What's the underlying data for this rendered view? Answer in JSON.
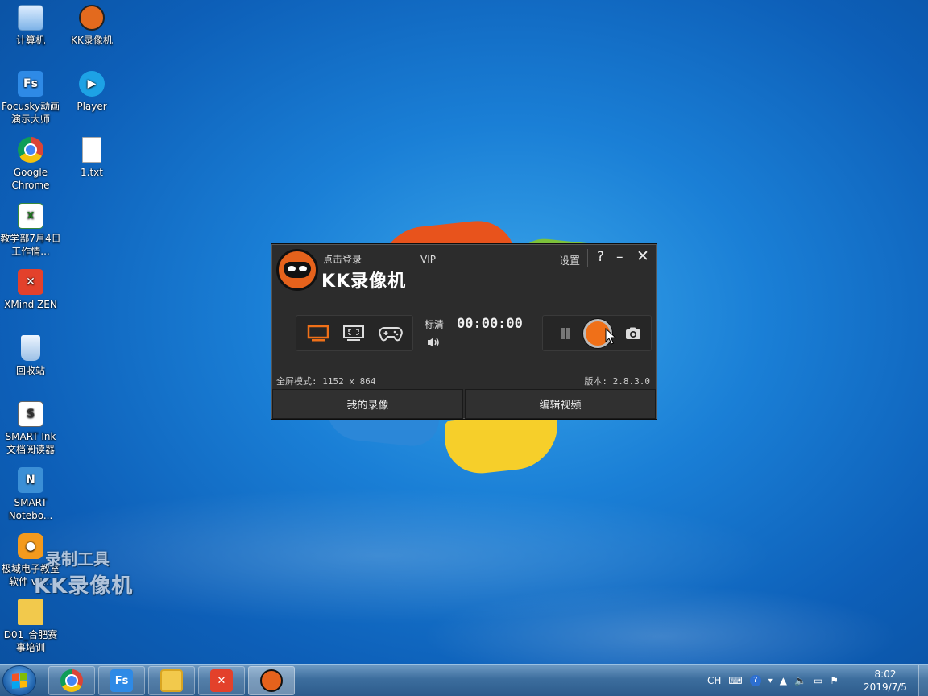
{
  "desktop": {
    "icons": [
      {
        "label": "计算机",
        "glyph": ""
      },
      {
        "label": "KK录像机",
        "glyph": ""
      },
      {
        "label": "Focusky动画演示大师",
        "glyph": "Fs"
      },
      {
        "label": "Player",
        "glyph": "▶"
      },
      {
        "label": "Google Chrome",
        "glyph": ""
      },
      {
        "label": "1.txt",
        "glyph": ""
      },
      {
        "label": "教学部7月4日工作情...",
        "glyph": "X"
      },
      {
        "label": "XMind ZEN",
        "glyph": "✕"
      },
      {
        "label": "回收站",
        "glyph": ""
      },
      {
        "label": "SMART Ink 文档阅读器",
        "glyph": "S"
      },
      {
        "label": "SMART Notebo...",
        "glyph": "N"
      },
      {
        "label": "极域电子教室软件 v4...",
        "glyph": "●"
      },
      {
        "label": "D01_合肥赛事培训",
        "glyph": ""
      }
    ]
  },
  "watermark": {
    "line1": "录制工具",
    "line2": "KK录像机"
  },
  "kk_window": {
    "login": "点击登录",
    "title": "KK录像机",
    "vip": "VIP",
    "settings": "设置",
    "help": "?",
    "minimize": "–",
    "close": "✕",
    "quality": "标清",
    "timer": "00:00:00",
    "fullscreen_mode": "全屏模式: 1152 x 864",
    "version": "版本: 2.8.3.0",
    "tab_my_recordings": "我的录像",
    "tab_edit_video": "编辑视频",
    "accent_color": "#f07018"
  },
  "taskbar": {
    "tray": {
      "lang": "CH"
    },
    "clock": {
      "time": "8:02",
      "date": "2019/7/5"
    }
  }
}
